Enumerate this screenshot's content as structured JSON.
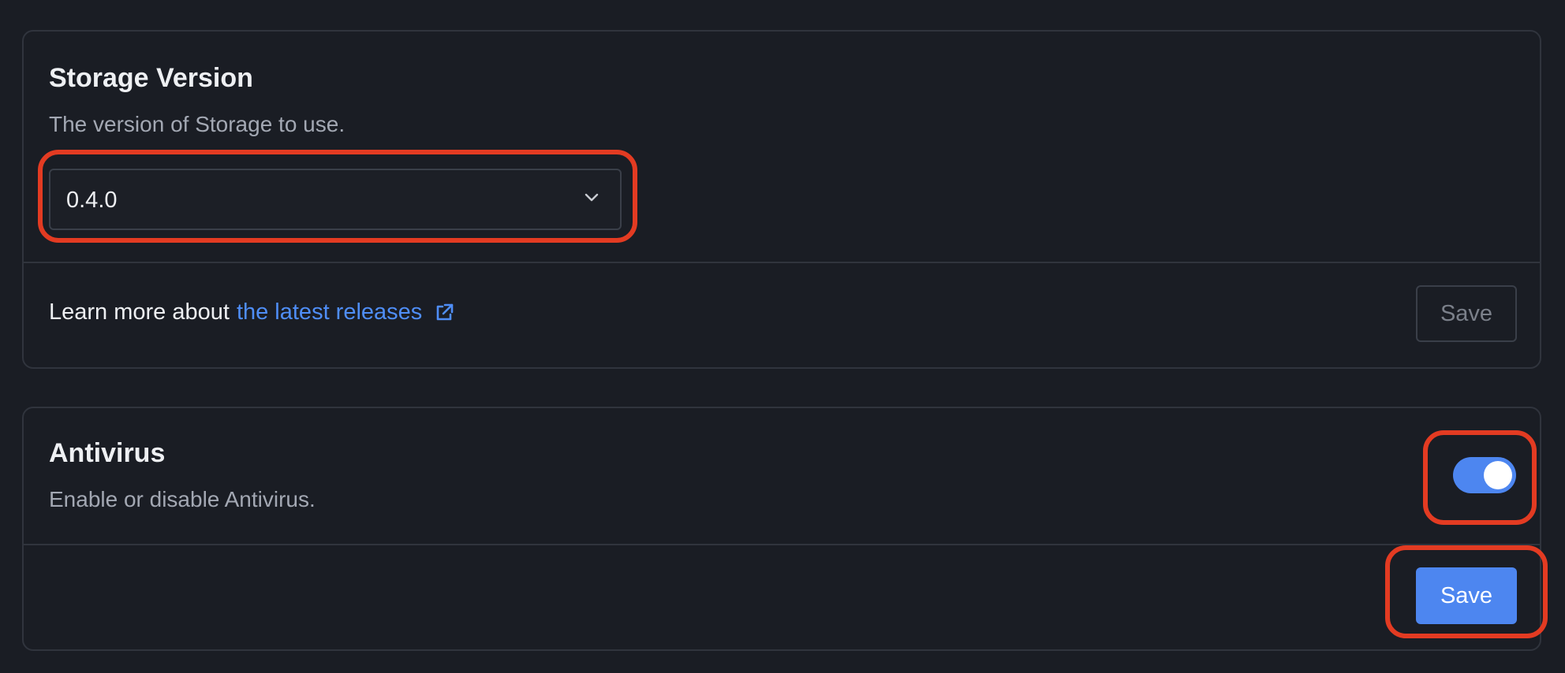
{
  "storage": {
    "title": "Storage Version",
    "description": "The version of Storage to use.",
    "selected_version": "0.4.0",
    "footer_prefix": "Learn more about",
    "footer_link": "the latest releases",
    "save_label": "Save"
  },
  "antivirus": {
    "title": "Antivirus",
    "description": "Enable or disable Antivirus.",
    "enabled": true,
    "save_label": "Save"
  },
  "colors": {
    "background": "#1a1d24",
    "accent": "#4d86f0",
    "link": "#4f8ef7",
    "annotation": "#e33b22"
  },
  "icons": [
    "chevron-down-icon",
    "external-link-icon"
  ]
}
